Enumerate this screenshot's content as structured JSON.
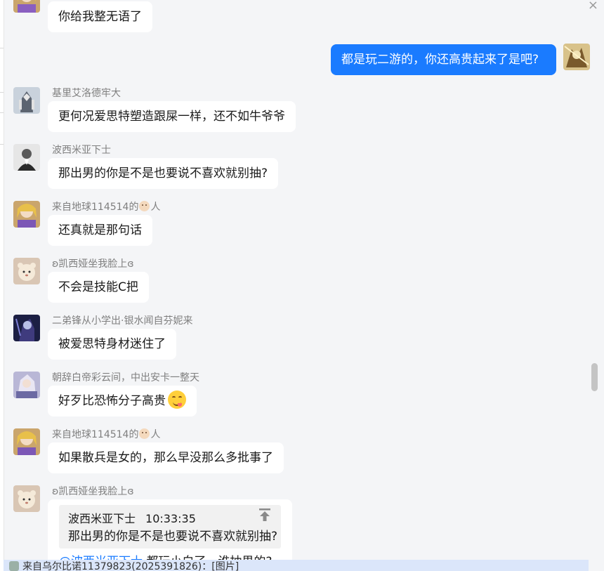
{
  "window": {
    "close_glyph": "×"
  },
  "conversation": {
    "messages": [
      {
        "name": "",
        "text": "你给我整无语了",
        "avatar_icon": "anime-girl-gold-icon"
      },
      {
        "name": "",
        "text": "都是玩二游的，你还高贵起来了是吧?",
        "mine": true,
        "avatar_icon": "golden-warrior-icon"
      },
      {
        "name": "基里艾洛德牢大",
        "text": "更何况爱思特塑造跟屎一样，还不如牛爷爷",
        "avatar_icon": "mecha-icon"
      },
      {
        "name": "波西米亚下士",
        "text": "那出男的你是不是也要说不喜欢就别抽?",
        "avatar_icon": "gentleman-portrait-icon"
      },
      {
        "name_prefix": "来自地球114514的",
        "name_suffix": "人",
        "name_emoji": "baby-face-emoji",
        "text": "还真就是那句话",
        "avatar_icon": "anime-girl-gold-icon"
      },
      {
        "name": "ʚ凯西娅坐我脸上ɞ",
        "text": "不会是技能C把",
        "avatar_icon": "hamster-icon"
      },
      {
        "name": "二弟锋从小学出·银水闻自芬妮来",
        "text": "被爱思特身材迷住了",
        "avatar_icon": "dark-anime-icon"
      },
      {
        "name": "朝辞白帝彩云间，中出安卡一整天",
        "text": "好歹比恐怖分子高贵",
        "text_emoji": "yum-face-emoji",
        "avatar_icon": "silver-hair-anime-icon"
      },
      {
        "name_prefix": "来自地球114514的",
        "name_suffix": "人",
        "name_emoji": "baby-face-emoji",
        "text": "如果散兵是女的，那么早没那么多批事了",
        "avatar_icon": "anime-girl-gold-icon"
      },
      {
        "name": "ʚ凯西娅坐我脸上ɞ",
        "avatar_icon": "hamster-icon"
      }
    ],
    "reply": {
      "quote_author": "波西米亚下士",
      "quote_time": "10:33:35",
      "quote_text": "那出男的你是不是也要说不喜欢就别抽?",
      "jump_icon": "jump-to-top-icon",
      "mention": "@波西米亚下士",
      "text": " 都玩小白了，谁抽男的?"
    }
  },
  "notification": {
    "text": "来自乌尔比诺11379823(2025391826)：[图片]",
    "icon": "group-avatar-icon"
  },
  "colors": {
    "accent": "#1a7bff",
    "background": "#f4f5f7",
    "bubble": "#ffffff",
    "banner": "#dbe6fa"
  }
}
